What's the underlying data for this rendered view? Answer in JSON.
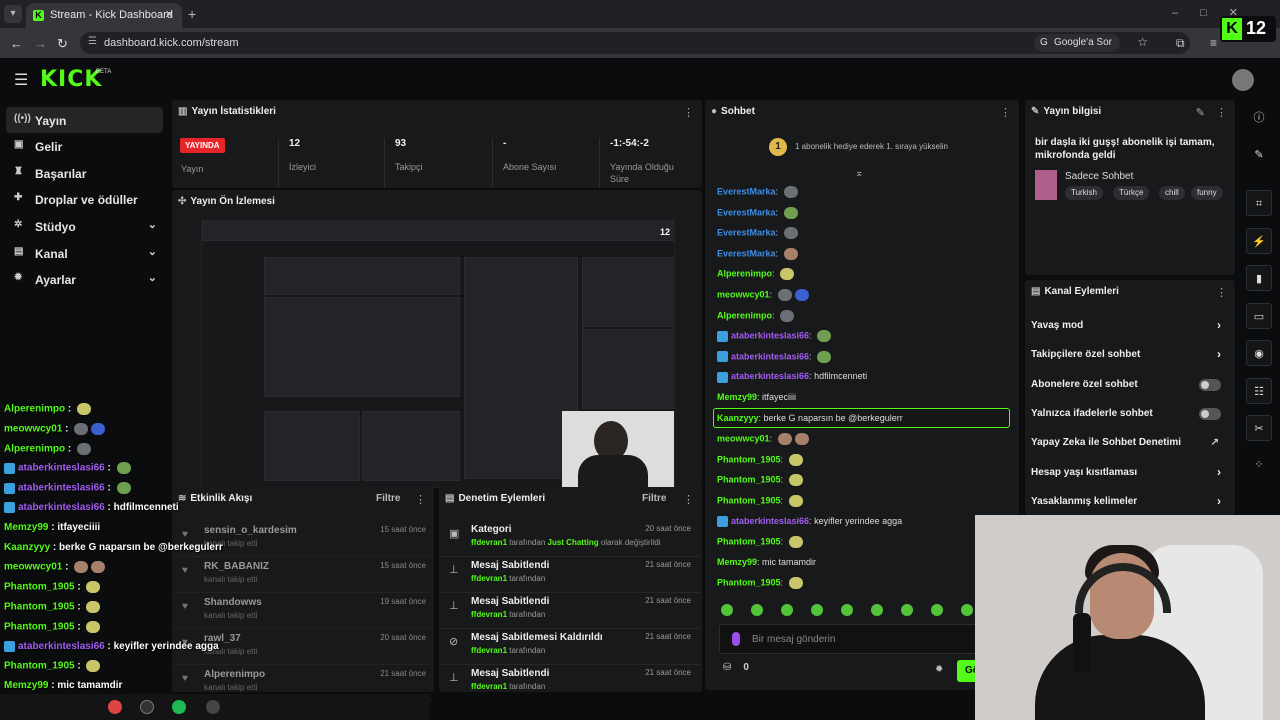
{
  "browser": {
    "tab_title": "Stream - Kick Dashboard",
    "url": "dashboard.kick.com/stream",
    "google_label": "Google'a Sor"
  },
  "overlay_badge": {
    "k": "K",
    "count": "12"
  },
  "header": {
    "logo": "KICK",
    "beta": "BETA"
  },
  "sidebar": {
    "items": [
      {
        "label": "Yayın",
        "icon": "broadcast-icon"
      },
      {
        "label": "Gelir",
        "icon": "money-icon"
      },
      {
        "label": "Başarılar",
        "icon": "trophy-icon"
      },
      {
        "label": "Droplar ve ödüller",
        "icon": "gift-icon"
      },
      {
        "label": "Stüdyo",
        "icon": "studio-icon"
      },
      {
        "label": "Kanal",
        "icon": "channel-icon"
      },
      {
        "label": "Ayarlar",
        "icon": "gear-icon"
      }
    ]
  },
  "stats": {
    "title": "Yayın İstatistikleri",
    "live_badge": "YAYINDA",
    "live_label": "Yayın",
    "items": [
      {
        "value": "12",
        "label": "İzleyici"
      },
      {
        "value": "93",
        "label": "Takipçi"
      },
      {
        "value": "-",
        "label": "Abone Sayısı"
      },
      {
        "value": "-1:-54:-2",
        "label": "Yayında Olduğu Süre"
      }
    ]
  },
  "preview": {
    "title": "Yayın Ön İzlemesi"
  },
  "activity": {
    "title": "Etkinlik Akışı",
    "filter": "Filtre",
    "items": [
      {
        "name": "sensin_o_kardesim",
        "sub": "kanalı takip etti",
        "time": "15 saat önce"
      },
      {
        "name": "RK_BABANIZ",
        "sub": "kanalı takip etti",
        "time": "15 saat önce"
      },
      {
        "name": "Shandowws",
        "sub": "kanalı takip etti",
        "time": "19 saat önce"
      },
      {
        "name": "rawl_37",
        "sub": "kanalı takip etti",
        "time": "20 saat önce"
      },
      {
        "name": "Alperenimpo",
        "sub": "kanalı takip etti",
        "time": "21 saat önce"
      }
    ]
  },
  "moderation": {
    "title": "Denetim Eylemleri",
    "filter": "Filtre",
    "items": [
      {
        "name": "Kategori",
        "user": "ffdevran1",
        "mid": " tarafından ",
        "hl": "Just Chatting",
        "tail": " olarak değiştirildi",
        "time": "20 saat önce"
      },
      {
        "name": "Mesaj Sabitlendi",
        "user": "ffdevran1",
        "mid": " tarafından",
        "hl": "",
        "tail": "",
        "time": "21 saat önce"
      },
      {
        "name": "Mesaj Sabitlendi",
        "user": "ffdevran1",
        "mid": " tarafından",
        "hl": "",
        "tail": "",
        "time": "21 saat önce"
      },
      {
        "name": "Mesaj Sabitlemesi Kaldırıldı",
        "user": "ffdevran1",
        "mid": " tarafından",
        "hl": "",
        "tail": "",
        "time": "21 saat önce"
      },
      {
        "name": "Mesaj Sabitlendi",
        "user": "ffdevran1",
        "mid": " tarafından",
        "hl": "",
        "tail": "",
        "time": "21 saat önce"
      }
    ]
  },
  "chat": {
    "title": "Sohbet",
    "gift_num": "1",
    "gift_text": "1 abonelik hediye ederek 1. sıraya yükselin",
    "placeholder": "Bir mesaj gönderin",
    "coins": "0",
    "send": "Gö",
    "messages": [
      {
        "user": "EverestMarka",
        "color": "#3b8eea",
        "text": "",
        "emotes": [
          "b"
        ]
      },
      {
        "user": "EverestMarka",
        "color": "#3b8eea",
        "text": "",
        "emotes": [
          "g"
        ]
      },
      {
        "user": "EverestMarka",
        "color": "#3b8eea",
        "text": "",
        "emotes": [
          "b"
        ]
      },
      {
        "user": "EverestMarka",
        "color": "#3b8eea",
        "text": "",
        "emotes": [
          "br"
        ]
      },
      {
        "user": "Alperenimpo",
        "color": "#53fc18",
        "text": "",
        "emotes": [
          "y"
        ]
      },
      {
        "user": "meowwcy01",
        "color": "#53fc18",
        "text": "",
        "emotes": [
          "b",
          "p"
        ]
      },
      {
        "user": "Alperenimpo",
        "color": "#53fc18",
        "text": "",
        "emotes": [
          "b"
        ]
      },
      {
        "user": "ataberkinteslasi66",
        "color": "#a35cf3",
        "text": "",
        "emotes": [
          "g"
        ],
        "badge": true
      },
      {
        "user": "ataberkinteslasi66",
        "color": "#a35cf3",
        "text": "",
        "emotes": [
          "g"
        ],
        "badge": true
      },
      {
        "user": "ataberkinteslasi66",
        "color": "#a35cf3",
        "text": "hdfilmcenneti",
        "emotes": [],
        "badge": true
      },
      {
        "user": "Memzy99",
        "color": "#53fc18",
        "text": "itfayeciiii",
        "emotes": []
      },
      {
        "user": "Kaanzyyy",
        "color": "#53fc18",
        "text": "berke G naparsın be @berkegulerr",
        "emotes": []
      },
      {
        "user": "meowwcy01",
        "color": "#53fc18",
        "text": "",
        "emotes": [
          "br",
          "br"
        ]
      },
      {
        "user": "Phantom_1905",
        "color": "#53fc18",
        "text": "",
        "emotes": [
          "y"
        ]
      },
      {
        "user": "Phantom_1905",
        "color": "#53fc18",
        "text": "",
        "emotes": [
          "y"
        ]
      },
      {
        "user": "Phantom_1905",
        "color": "#53fc18",
        "text": "",
        "emotes": [
          "y"
        ]
      },
      {
        "user": "ataberkinteslasi66",
        "color": "#a35cf3",
        "text": "keyifler yerindee agga",
        "emotes": [],
        "badge": true
      },
      {
        "user": "Phantom_1905",
        "color": "#53fc18",
        "text": "",
        "emotes": [
          "y"
        ]
      },
      {
        "user": "Memzy99",
        "color": "#53fc18",
        "text": "mic tamamdir",
        "emotes": []
      },
      {
        "user": "Phantom_1905",
        "color": "#53fc18",
        "text": "",
        "emotes": [
          "y"
        ]
      }
    ]
  },
  "info": {
    "title": "Yayın bilgisi",
    "stream_title": "bir daşla iki guşş! abonelik işi tamam, mikrofonda geldi",
    "category": "Sadece Sohbet",
    "tags": [
      "Turkish",
      "Türkçe",
      "chill",
      "funny"
    ]
  },
  "channel_actions": {
    "title": "Kanal Eylemleri",
    "items": [
      {
        "label": "Yavaş mod",
        "ctl": "arrow"
      },
      {
        "label": "Takipçilere özel sohbet",
        "ctl": "arrow"
      },
      {
        "label": "Abonelere özel sohbet",
        "ctl": "toggle"
      },
      {
        "label": "Yalnızca ifadelerle sohbet",
        "ctl": "toggle"
      },
      {
        "label": "Yapay Zeka ile Sohbet Denetimi",
        "ctl": "ext"
      },
      {
        "label": "Hesap yaşı kısıtlaması",
        "ctl": "arrow"
      },
      {
        "label": "Yasaklanmış kelimeler",
        "ctl": "arrow"
      }
    ]
  },
  "overlay_chat": [
    {
      "user": "Alperenimpo",
      "color": "#53fc18",
      "text": "",
      "emo": "y"
    },
    {
      "user": "meowwcy01",
      "color": "#53fc18",
      "text": "",
      "emo": "bp"
    },
    {
      "user": "Alperenimpo",
      "color": "#53fc18",
      "text": "",
      "emo": "b"
    },
    {
      "user": "ataberkinteslasi66",
      "color": "#a35cf3",
      "text": "",
      "emo": "g",
      "badge": true
    },
    {
      "user": "ataberkinteslasi66",
      "color": "#a35cf3",
      "text": "",
      "emo": "g",
      "badge": true
    },
    {
      "user": "ataberkinteslasi66",
      "color": "#a35cf3",
      "text": "hdfilmcenneti",
      "emo": "",
      "badge": true
    },
    {
      "user": "Memzy99",
      "color": "#53fc18",
      "text": "itfayeciiii",
      "emo": ""
    },
    {
      "user": "Kaanzyyy",
      "color": "#53fc18",
      "text": "berke G naparsın be @berkegulerr",
      "emo": ""
    },
    {
      "user": "meowwcy01",
      "color": "#53fc18",
      "text": "",
      "emo": "brbr"
    },
    {
      "user": "Phantom_1905",
      "color": "#53fc18",
      "text": "",
      "emo": "y"
    },
    {
      "user": "Phantom_1905",
      "color": "#53fc18",
      "text": "",
      "emo": "y"
    },
    {
      "user": "Phantom_1905",
      "color": "#53fc18",
      "text": "",
      "emo": "y"
    },
    {
      "user": "ataberkinteslasi66",
      "color": "#a35cf3",
      "text": "keyifler yerindee agga",
      "emo": "",
      "badge": true
    },
    {
      "user": "Phantom_1905",
      "color": "#53fc18",
      "text": "",
      "emo": "y"
    },
    {
      "user": "Memzy99",
      "color": "#53fc18",
      "text": "mic tamamdir",
      "emo": ""
    },
    {
      "user": "Phantom_1905",
      "color": "#53fc18",
      "text": "",
      "emo": "y"
    }
  ]
}
